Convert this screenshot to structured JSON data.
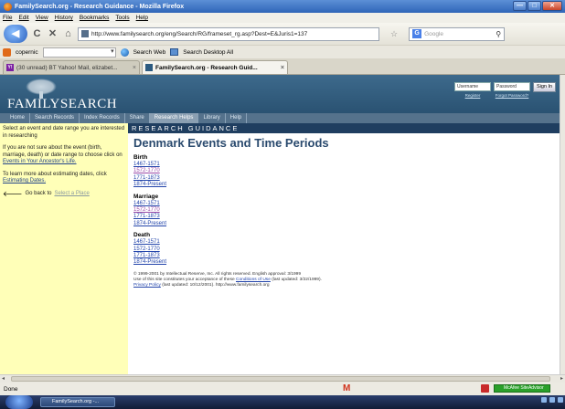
{
  "window": {
    "title": "FamilySearch.org - Research Guidance - Mozilla Firefox",
    "min": "—",
    "max": "□",
    "close": "✕"
  },
  "menu": [
    "File",
    "Edit",
    "View",
    "History",
    "Bookmarks",
    "Tools",
    "Help"
  ],
  "navbar": {
    "url": "http://www.familysearch.org/eng/Search/RG/frameset_rg.asp?Dest=E&Juris1=137",
    "search_placeholder": "Google"
  },
  "toolbar2": {
    "copernic": "copernic",
    "search_web": "Search Web",
    "search_desktop": "Search Desktop All"
  },
  "tabs": [
    {
      "label": "(30 unread) BT Yahoo! Mail, elizabet...",
      "close": "×"
    },
    {
      "label": "FamilySearch.org - Research Guid...",
      "close": "×"
    }
  ],
  "header": {
    "logo": "FAMILYSEARCH",
    "username_placeholder": "Username",
    "password_placeholder": "Password",
    "register": "Register",
    "forgot": "Forgot Password?",
    "signin": "Sign In"
  },
  "site_nav": [
    "Home",
    "Search Records",
    "Index Records",
    "Share",
    "Research Helps",
    "Library",
    "Help"
  ],
  "sidebar": {
    "intro": "Select an event and date range you are interested in researching",
    "p1_pre": "If you are not sure about the event (birth, marriage, death) or date range to choose click on ",
    "p1_link": "Events in Your Ancestor's Life.",
    "p2_pre": "To learn more about estimating dates, click ",
    "p2_link": "Estimating Dates.",
    "back_pre": "Go back to ",
    "back_link": "Select a Place"
  },
  "rg_bar": "RESEARCH GUIDANCE",
  "main": {
    "title": "Denmark Events and Time Periods",
    "sections": [
      {
        "title": "Birth",
        "links": [
          "1467-1571",
          "1572-1770",
          "1771-1873",
          "1874-Present"
        ]
      },
      {
        "title": "Marriage",
        "links": [
          "1467-1571",
          "1572-1770",
          "1771-1873",
          "1874-Present"
        ]
      },
      {
        "title": "Death",
        "links": [
          "1467-1571",
          "1572-1770",
          "1771-1873",
          "1874-Present"
        ]
      }
    ],
    "footer": {
      "line1": "© 1999-2001 by Intellectual Reserve, Inc. All rights reserved. English approval: 3/1999",
      "line2_pre": "Use of this site constitutes your acceptance of these ",
      "line2_link": "Conditions of Use",
      "line2_post": " (last updated: 3/22/1999).",
      "line3_link": "Privacy Policy",
      "line3_post": " (last updated: 10/12/2001). http://www.familysearch.org"
    }
  },
  "status": {
    "text": "Done",
    "mcafee": "McAfee SiteAdvisor"
  },
  "taskbar": {
    "task": "FamilySearch.org -..."
  }
}
